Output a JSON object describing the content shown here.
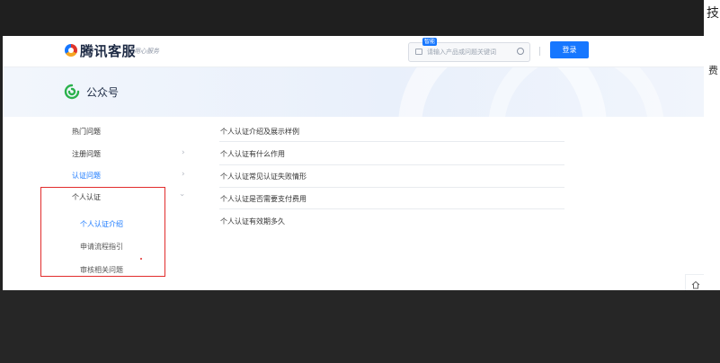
{
  "edge": {
    "tech_char": "技",
    "fee_char": "费"
  },
  "header": {
    "brand": "腾讯客服",
    "brand_sub": "用心服务",
    "search_badge": "智能",
    "search_placeholder": "请输入产品或问题关键词",
    "login_label": "登录"
  },
  "banner": {
    "title": "公众号"
  },
  "sidebar": {
    "items": [
      {
        "label": "热门问题"
      },
      {
        "label": "注册问题"
      },
      {
        "label": "认证问题"
      },
      {
        "label": "个人认证"
      }
    ],
    "sub_items": [
      {
        "label": "个人认证介绍"
      },
      {
        "label": "申请流程指引"
      },
      {
        "label": "审核相关问题"
      }
    ]
  },
  "articles": [
    {
      "title": "个人认证介绍及展示样例"
    },
    {
      "title": "个人认证有什么作用"
    },
    {
      "title": "个人认证常见认证失败情形"
    },
    {
      "title": "个人认证是否需要支付费用"
    },
    {
      "title": "个人认证有效期多久"
    }
  ],
  "colors": {
    "accent": "#1677ff",
    "highlight": "#e12c2c",
    "brand_dark": "#1d2a44"
  },
  "icons": {
    "brand": "tencent-logo-icon",
    "banner": "wechat-official-account-icon",
    "search": "search-icon",
    "float": "home-icon"
  }
}
